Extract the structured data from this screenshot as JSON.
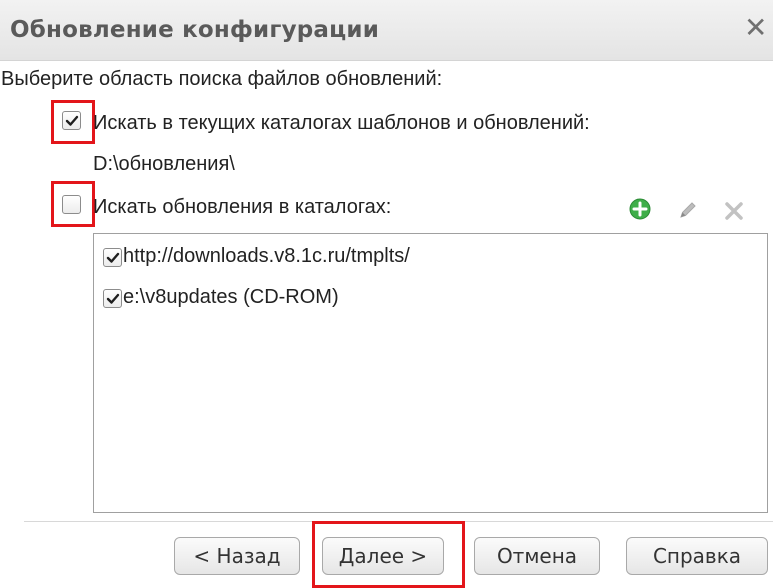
{
  "dialog": {
    "title": "Обновление конфигурации",
    "close_icon": "close-icon"
  },
  "search_area_label": "Выберите область поиска файлов обновлений:",
  "option_current_catalogs": {
    "label": "Искать в текущих каталогах шаблонов и обновлений:",
    "checked": true,
    "path": "D:\\обновления\\"
  },
  "option_search_catalogs": {
    "label": "Искать обновления в каталогах:",
    "checked": false
  },
  "toolbar": {
    "add_icon": "add-icon",
    "edit_icon": "pencil-icon",
    "delete_icon": "delete-icon"
  },
  "catalogs": [
    {
      "label": "http://downloads.v8.1c.ru/tmplts/",
      "checked": true
    },
    {
      "label": "e:\\v8updates (CD-ROM)",
      "checked": true
    }
  ],
  "buttons": {
    "back": "< Назад",
    "next": "Далее >",
    "cancel": "Отмена",
    "help": "Справка"
  },
  "colors": {
    "highlight": "#e3151a",
    "add_icon": "#3fae49"
  }
}
